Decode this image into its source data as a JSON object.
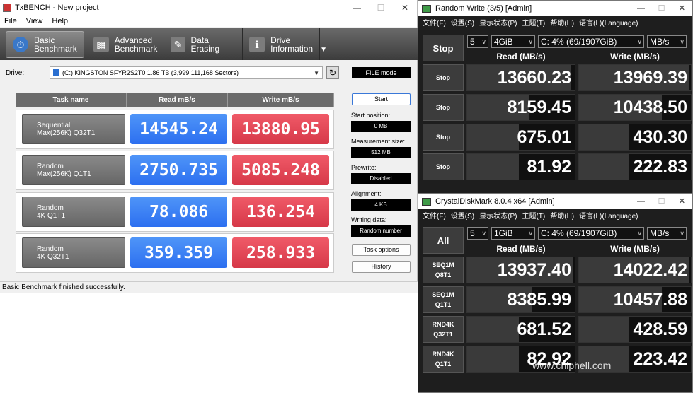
{
  "txbench": {
    "title": "TxBENCH - New project",
    "menu": [
      "File",
      "View",
      "Help"
    ],
    "nav": [
      {
        "line1": "Basic",
        "line2": "Benchmark"
      },
      {
        "line1": "Advanced",
        "line2": "Benchmark"
      },
      {
        "line1": "Data Erasing",
        "line2": ""
      },
      {
        "line1": "Drive",
        "line2": "Information"
      }
    ],
    "drive_label": "Drive:",
    "drive_value": "(C:) KINGSTON SFYR2S2T0  1.86 TB (3,999,111,168 Sectors)",
    "file_mode": "FILE mode",
    "headers": {
      "task": "Task name",
      "read": "Read mB/s",
      "write": "Write mB/s"
    },
    "rows": [
      {
        "task_l1": "Sequential",
        "task_l2": "Max(256K) Q32T1",
        "read": "14545.24",
        "write": "13880.95"
      },
      {
        "task_l1": "Random",
        "task_l2": "Max(256K) Q1T1",
        "read": "2750.735",
        "write": "5085.248"
      },
      {
        "task_l1": "Random",
        "task_l2": "4K Q1T1",
        "read": "78.086",
        "write": "136.254"
      },
      {
        "task_l1": "Random",
        "task_l2": "4K Q32T1",
        "read": "359.359",
        "write": "258.933"
      }
    ],
    "start": "Start",
    "start_position_label": "Start position:",
    "start_position": "0 MB",
    "measurement_size_label": "Measurement size:",
    "measurement_size": "512 MB",
    "prewrite_label": "Prewrite:",
    "prewrite": "Disabled",
    "alignment_label": "Alignment:",
    "alignment": "4 KB",
    "writing_data_label": "Writing data:",
    "writing_data": "Random number",
    "task_options": "Task options",
    "history": "History",
    "status": "Basic Benchmark finished successfully."
  },
  "cdm_top": {
    "title": "Random Write (3/5) [Admin]",
    "menu": [
      "文件(F)",
      "设置(S)",
      "显示状态(P)",
      "主题(T)",
      "帮助(H)",
      "语言(L)(Language)"
    ],
    "count": "5",
    "size": "4GiB",
    "drive": "C: 4% (69/1907GiB)",
    "unit": "MB/s",
    "all_button": "Stop",
    "read_header": "Read (MB/s)",
    "write_header": "Write (MB/s)",
    "rows": [
      {
        "label": "Stop",
        "read": "13660.23",
        "write": "13969.39",
        "read_frac": 0.97,
        "write_frac": 0.99
      },
      {
        "label": "Stop",
        "read": "8159.45",
        "write": "10438.50",
        "read_frac": 0.58,
        "write_frac": 0.74
      },
      {
        "label": "Stop",
        "read": "675.01",
        "write": "430.30",
        "read_frac": 0.48,
        "write_frac": 0.44
      },
      {
        "label": "Stop",
        "read": "81.92",
        "write": "222.83",
        "read_frac": 0.48,
        "write_frac": 0.44
      }
    ]
  },
  "cdm_bottom": {
    "title": "CrystalDiskMark 8.0.4 x64 [Admin]",
    "menu": [
      "文件(F)",
      "设置(S)",
      "显示状态(P)",
      "主题(T)",
      "帮助(H)",
      "语言(L)(Language)"
    ],
    "count": "5",
    "size": "1GiB",
    "drive": "C: 4% (69/1907GiB)",
    "unit": "MB/s",
    "all_button": "All",
    "read_header": "Read (MB/s)",
    "write_header": "Write (MB/s)",
    "rows": [
      {
        "label": "SEQ1M\nQ8T1",
        "read": "13937.40",
        "write": "14022.42",
        "read_frac": 0.98,
        "write_frac": 0.99
      },
      {
        "label": "SEQ1M\nQ1T1",
        "read": "8385.99",
        "write": "10457.88",
        "read_frac": 0.6,
        "write_frac": 0.74
      },
      {
        "label": "RND4K\nQ32T1",
        "read": "681.52",
        "write": "428.59",
        "read_frac": 0.48,
        "write_frac": 0.44
      },
      {
        "label": "RND4K\nQ1T1",
        "read": "82.92",
        "write": "223.42",
        "read_frac": 0.48,
        "write_frac": 0.44
      }
    ]
  },
  "watermark": "www.chiphell.com"
}
